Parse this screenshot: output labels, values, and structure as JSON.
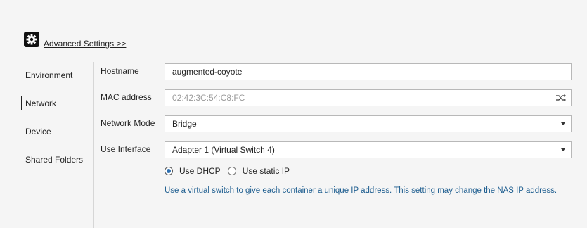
{
  "advanced": {
    "icon": "gear-icon",
    "link_label": "Advanced Settings >>"
  },
  "sidebar": {
    "items": [
      {
        "label": "Environment",
        "active": false
      },
      {
        "label": "Network",
        "active": true
      },
      {
        "label": "Device",
        "active": false
      },
      {
        "label": "Shared Folders",
        "active": false
      }
    ]
  },
  "form": {
    "hostname": {
      "label": "Hostname",
      "value": "augmented-coyote"
    },
    "mac": {
      "label": "MAC address",
      "value": "02:42:3C:54:C8:FC",
      "icon": "shuffle-icon"
    },
    "network_mode": {
      "label": "Network Mode",
      "value": "Bridge"
    },
    "use_interface": {
      "label": "Use Interface",
      "value": "Adapter 1 (Virtual Switch 4)"
    },
    "ip_mode": {
      "options": [
        {
          "label": "Use DHCP",
          "checked": true
        },
        {
          "label": "Use static IP",
          "checked": false
        }
      ]
    },
    "note": "Use a virtual switch to give each container a unique IP address. This setting may change the NAS IP address."
  },
  "colors": {
    "note": "#1d5d8f",
    "radio_accent": "#2d6fb0"
  }
}
